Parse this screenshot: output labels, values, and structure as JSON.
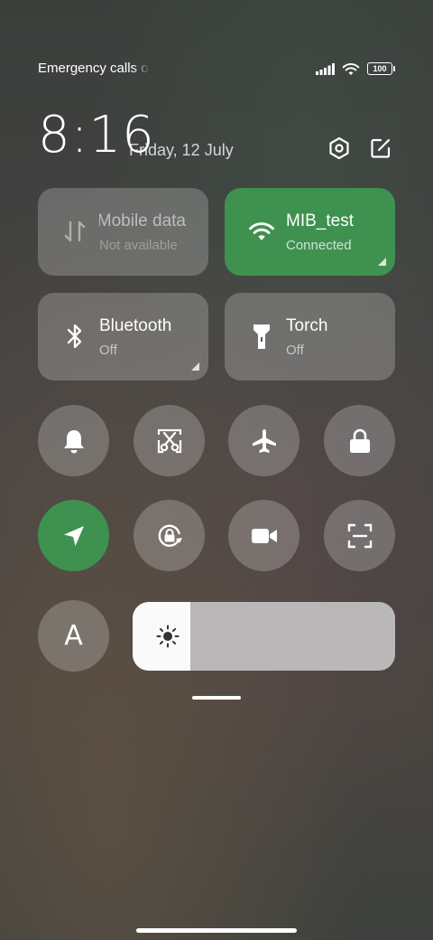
{
  "status_bar": {
    "carrier_text": "Emergency calls o",
    "battery_level": "100",
    "signal_icon": "signal-bars-icon",
    "wifi_icon": "wifi-icon"
  },
  "header": {
    "time": "8:16",
    "date": "Friday, 12 July",
    "settings_icon": "settings-hexagon-icon",
    "edit_icon": "edit-icon"
  },
  "tiles": {
    "mobile_data": {
      "label": "Mobile data",
      "status": "Not available",
      "icon": "mobile-data-arrows-icon"
    },
    "wifi": {
      "label": "MIB_test",
      "status": "Connected",
      "icon": "wifi-icon"
    },
    "bluetooth": {
      "label": "Bluetooth",
      "status": "Off",
      "icon": "bluetooth-icon"
    },
    "torch": {
      "label": "Torch",
      "status": "Off",
      "icon": "torch-icon"
    }
  },
  "toggles": [
    {
      "name": "silent",
      "icon": "bell-icon",
      "active": false
    },
    {
      "name": "screenshot",
      "icon": "scissors-screenshot-icon",
      "active": false
    },
    {
      "name": "airplane-mode",
      "icon": "airplane-icon",
      "active": false
    },
    {
      "name": "lock-screen",
      "icon": "lock-icon",
      "active": false
    },
    {
      "name": "location",
      "icon": "location-arrow-icon",
      "active": true
    },
    {
      "name": "rotation-lock",
      "icon": "rotation-lock-icon",
      "active": false
    },
    {
      "name": "screen-recorder",
      "icon": "video-camera-icon",
      "active": false
    },
    {
      "name": "scanner",
      "icon": "scan-frame-icon",
      "active": false
    },
    {
      "name": "auto-brightness",
      "icon": "letter-a-icon",
      "active": false
    }
  ],
  "auto_brightness_label": "A",
  "brightness": {
    "level": 0.22,
    "icon": "sun-icon"
  },
  "colors": {
    "accent_green": "#3f9150",
    "tile_bg": "rgba(255,255,255,0.22)",
    "slider_fill": "#fafafa",
    "slider_track": "#b9b7b7"
  }
}
